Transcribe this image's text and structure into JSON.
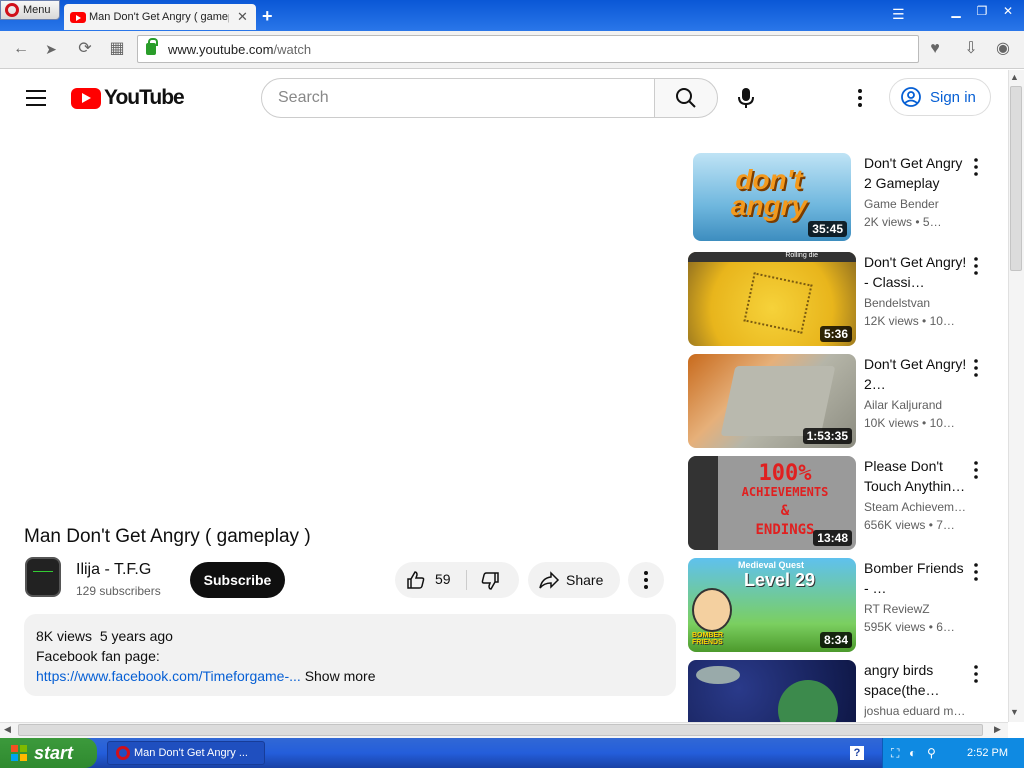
{
  "browser": {
    "menu_label": "Menu",
    "tab_title": "Man Don't Get Angry ( gameplay ) - YouTube",
    "url_host": "www.youtube.com",
    "url_path": "/watch"
  },
  "header": {
    "logo_text": "YouTube",
    "search_placeholder": "Search",
    "signin_label": "Sign in"
  },
  "video": {
    "title": "Man Don't Get Angry ( gameplay )",
    "channel_name": "Ilija - T.F.G",
    "channel_subs": "129 subscribers",
    "subscribe_label": "Subscribe",
    "likes": "59",
    "share_label": "Share",
    "views": "8K views",
    "age": "5 years ago",
    "desc_line1": "Facebook fan page:",
    "desc_link": "https://www.facebook.com/Timeforgame-...",
    "show_more": "Show more"
  },
  "recommendations": [
    {
      "title": "Don't Get Angry 2 Gameplay",
      "channel": "Game Bender",
      "views": "2K views",
      "age": "5…",
      "duration": "35:45"
    },
    {
      "title": "Don't Get Angry! - Classi…",
      "channel": "Bendelstvan",
      "views": "12K views",
      "age": "10…",
      "duration": "5:36"
    },
    {
      "title": "Don't Get Angry! 2…",
      "channel": "Ailar Kaljurand",
      "views": "10K views",
      "age": "10…",
      "duration": "1:53:35"
    },
    {
      "title": "Please Don't Touch Anythin…",
      "channel": "Steam Achievem…",
      "views": "656K views",
      "age": "7…",
      "duration": "13:48"
    },
    {
      "title": "Bomber Friends - …",
      "channel": "RT ReviewZ",
      "views": "595K views",
      "age": "6…",
      "duration": "8:34"
    },
    {
      "title": "angry birds space(the…",
      "channel": "joshua eduard m…",
      "views": "",
      "age": "",
      "duration": ""
    }
  ],
  "thumb_text": {
    "r1": "don't angry",
    "r2": "Rolling die",
    "r4_line1": "100%",
    "r4_line2": "ACHIEVEMENTS",
    "r4_line3": "&",
    "r4_line4": "ENDINGS",
    "r5_line1": "Medieval Quest",
    "r5_line2": "Level 29",
    "r5_line3": "BOMBER FRIENDS"
  },
  "taskbar": {
    "start_label": "start",
    "task_title": "Man Don't Get Angry ...",
    "clock": "2:52 PM"
  },
  "colors": {
    "yt_red": "#ff0000",
    "link_blue": "#065fd4",
    "xp_blue": "#245edb",
    "xp_green": "#3c9a3c"
  }
}
